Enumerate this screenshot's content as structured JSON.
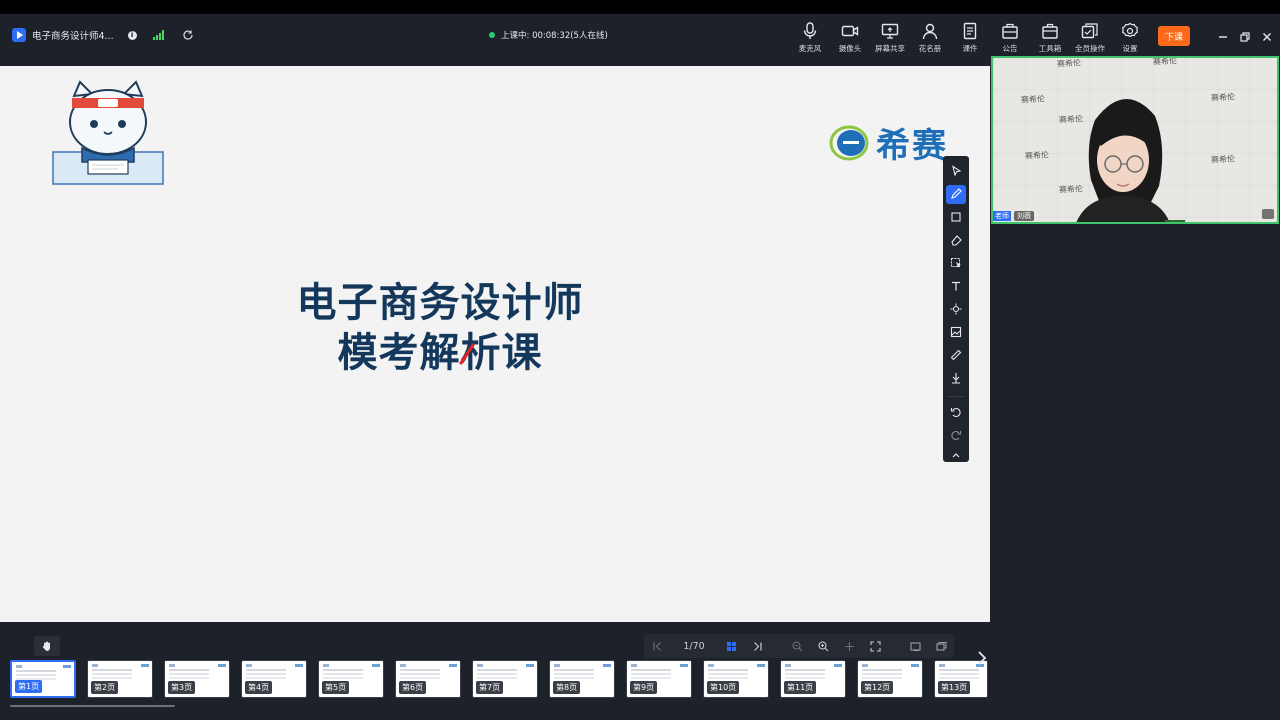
{
  "titlebar": {
    "app_title": "电子商务设计师4...",
    "status": "上课中: 00:08:32(5人在线)",
    "end_class_label": "下课",
    "tools": [
      {
        "label": "麦克风",
        "icon": "mic-icon"
      },
      {
        "label": "摄像头",
        "icon": "camera-icon"
      },
      {
        "label": "屏幕共享",
        "icon": "screen-share-icon"
      },
      {
        "label": "花名册",
        "icon": "roster-icon"
      },
      {
        "label": "课件",
        "icon": "courseware-icon"
      },
      {
        "label": "公告",
        "icon": "notice-icon"
      },
      {
        "label": "工具箱",
        "icon": "toolbox-icon"
      },
      {
        "label": "全员操作",
        "icon": "all-members-icon"
      },
      {
        "label": "设置",
        "icon": "settings-icon"
      }
    ]
  },
  "slide": {
    "brand_text": "希赛",
    "title_line1": "电子商务设计师",
    "title_line2": "模考解析课"
  },
  "video": {
    "role_label": "老师",
    "teacher_name": "刘薇",
    "wall_mark": "赛希伦"
  },
  "pager": {
    "page_indicator": "1/70"
  },
  "thumbnails": [
    "第1页",
    "第2页",
    "第3页",
    "第4页",
    "第5页",
    "第6页",
    "第7页",
    "第8页",
    "第9页",
    "第10页",
    "第11页",
    "第12页",
    "第13页"
  ],
  "colors": {
    "accent": "#2f6df6",
    "end_class": "#ff6a1a",
    "title_text": "#14375c",
    "live_indicator": "#2ecc71"
  }
}
